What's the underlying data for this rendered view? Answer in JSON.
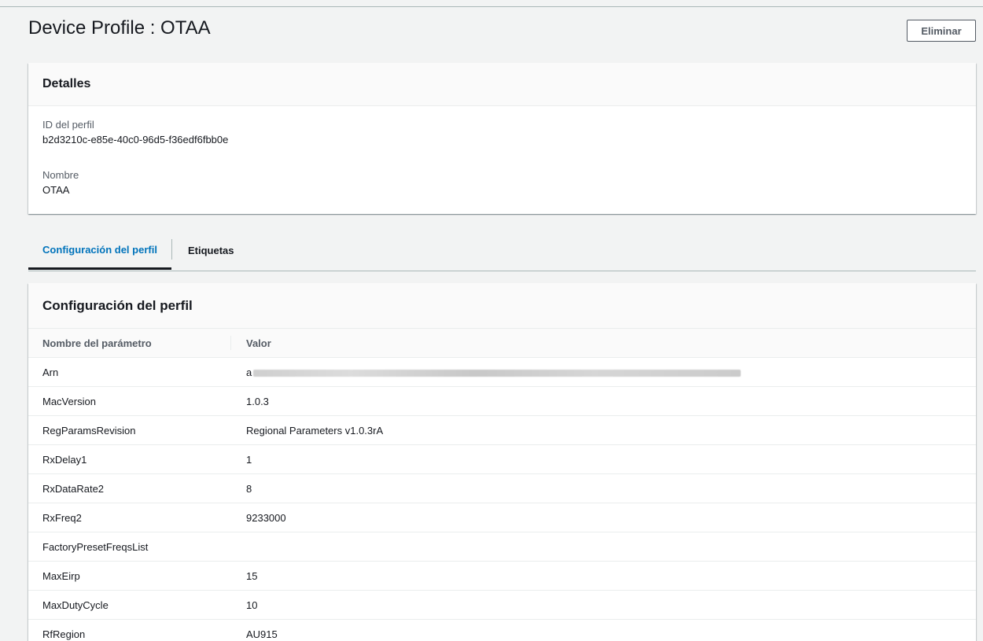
{
  "page": {
    "title": "Device Profile : OTAA",
    "delete_label": "Eliminar"
  },
  "details": {
    "heading": "Detalles",
    "profile_id_label": "ID del perfil",
    "profile_id_value": "b2d3210c-e85e-40c0-96d5-f36edf6fbb0e",
    "name_label": "Nombre",
    "name_value": "OTAA"
  },
  "tabs": [
    {
      "label": "Configuración del perfil",
      "active": true
    },
    {
      "label": "Etiquetas",
      "active": false
    }
  ],
  "config": {
    "heading": "Configuración del perfil",
    "columns": [
      "Nombre del parámetro",
      "Valor"
    ],
    "rows": [
      {
        "name": "Arn",
        "value": "a",
        "redacted": true
      },
      {
        "name": "MacVersion",
        "value": "1.0.3"
      },
      {
        "name": "RegParamsRevision",
        "value": "Regional Parameters v1.0.3rA"
      },
      {
        "name": "RxDelay1",
        "value": "1"
      },
      {
        "name": "RxDataRate2",
        "value": "8"
      },
      {
        "name": "RxFreq2",
        "value": "9233000"
      },
      {
        "name": "FactoryPresetFreqsList",
        "value": ""
      },
      {
        "name": "MaxEirp",
        "value": "15"
      },
      {
        "name": "MaxDutyCycle",
        "value": "10"
      },
      {
        "name": "RfRegion",
        "value": "AU915"
      }
    ]
  },
  "colors": {
    "accent": "#0073bb",
    "background": "#f2f3f3",
    "text": "#16191f"
  }
}
